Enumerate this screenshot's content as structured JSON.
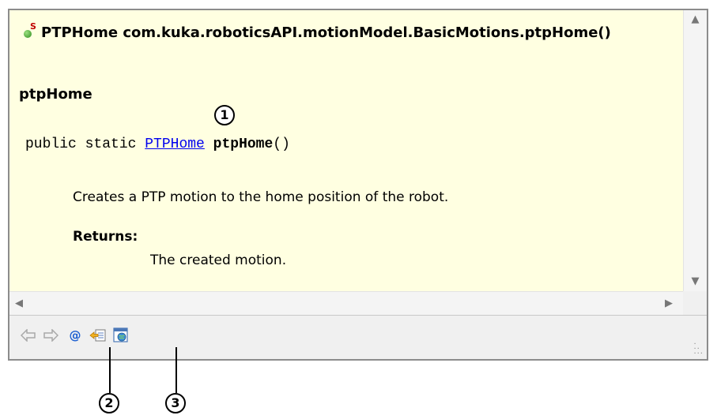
{
  "popup": {
    "title": "PTPHome com.kuka.roboticsAPI.motionModel.BasicMotions.ptpHome()",
    "static_marker": "S",
    "method_name": "ptpHome",
    "signature": {
      "prefix": "public static ",
      "return_type_link": "PTPHome",
      "method": "ptpHome",
      "params": "()"
    },
    "description": "Creates a PTP motion to the home position of the robot.",
    "returns_label": "Returns:",
    "returns_text": "The created motion."
  },
  "toolbar": {
    "buttons": [
      {
        "icon": "back-arrow-icon",
        "enabled": false
      },
      {
        "icon": "forward-arrow-icon",
        "enabled": false
      },
      {
        "icon": "at-sign-icon",
        "enabled": true
      },
      {
        "icon": "open-declaration-icon",
        "enabled": true
      },
      {
        "icon": "open-in-browser-icon",
        "enabled": true
      }
    ]
  },
  "callouts": {
    "one": "1",
    "two": "2",
    "three": "3"
  },
  "colors": {
    "popup_background": "#ffffe1",
    "link": "#0000ee",
    "static_marker": "#c00000"
  }
}
